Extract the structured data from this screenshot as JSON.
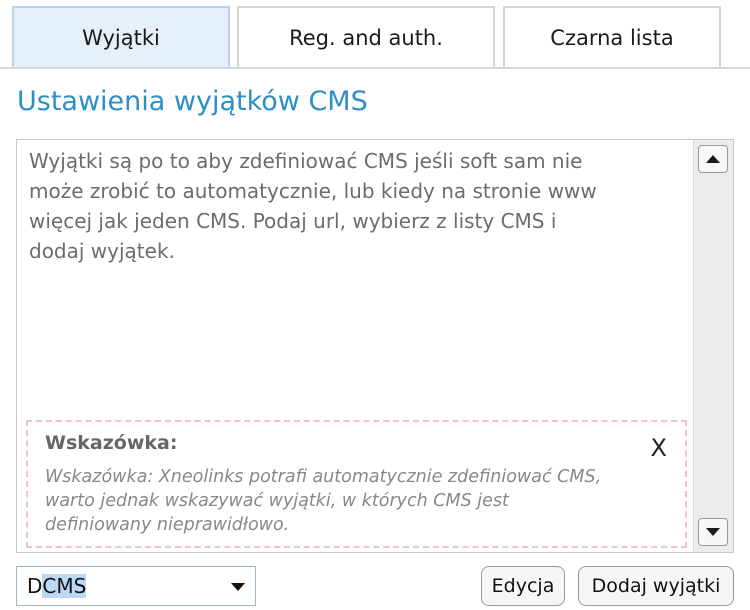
{
  "tabs": [
    {
      "label": "Wyjątki"
    },
    {
      "label": "Reg. and auth."
    },
    {
      "label": "Czarna lista"
    }
  ],
  "page": {
    "title": "Ustawienia wyjątków CMS"
  },
  "description": {
    "lines": [
      "Wyjątki są po to aby zdefiniować CMS jeśli soft sam nie",
      "może zrobić to automatycznie, lub kiedy na stronie www",
      "więcej jak jeden CMS. Podaj url, wybierz z listy CMS i",
      "dodaj wyjątek."
    ]
  },
  "hint": {
    "title": "Wskazówka:",
    "close": "X",
    "lines": [
      "Wskazówka: Xneolinks potrafi automatycznie zdefiniować CMS,",
      "warto jednak wskazywać wyjątki, w których CMS jest",
      "definiowany nieprawidłowo."
    ]
  },
  "cms_select": {
    "value_prefix": "D",
    "value_selected": "CMS"
  },
  "buttons": {
    "edit": "Edycja",
    "add": "Dodaj wyjątki"
  },
  "colors": {
    "title": "#2e8fc7",
    "active_tab": "#e6f0fb",
    "hint_border": "#f3c2c8"
  }
}
